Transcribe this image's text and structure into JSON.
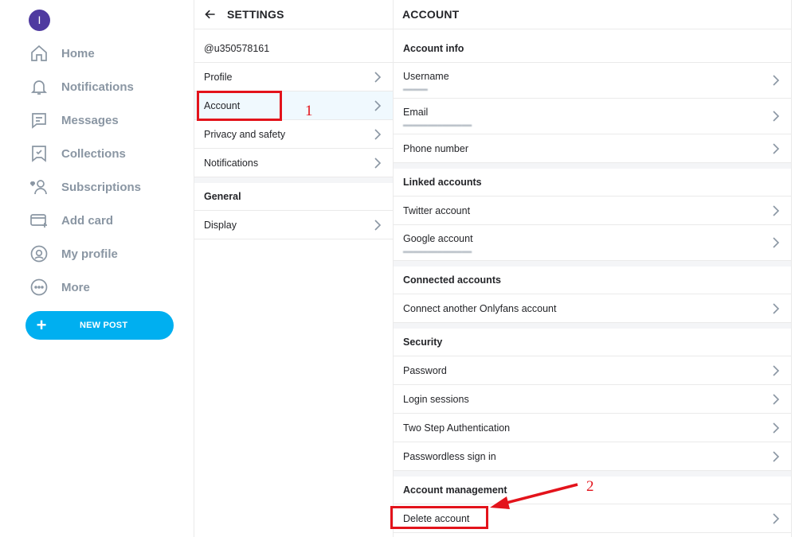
{
  "nav": {
    "avatar_initial": "I",
    "items": [
      {
        "label": "Home",
        "icon": "home-icon"
      },
      {
        "label": "Notifications",
        "icon": "bell-icon"
      },
      {
        "label": "Messages",
        "icon": "message-icon"
      },
      {
        "label": "Collections",
        "icon": "bookmark-icon"
      },
      {
        "label": "Subscriptions",
        "icon": "subscriptions-icon"
      },
      {
        "label": "Add card",
        "icon": "card-icon"
      },
      {
        "label": "My profile",
        "icon": "profile-icon"
      },
      {
        "label": "More",
        "icon": "more-icon"
      }
    ],
    "new_post_label": "NEW POST"
  },
  "settings": {
    "title": "SETTINGS",
    "username": "@u350578161",
    "items": [
      "Profile",
      "Account",
      "Privacy and safety",
      "Notifications"
    ],
    "active_item": "Account",
    "general_heading": "General",
    "general_items": [
      "Display"
    ]
  },
  "account": {
    "title": "ACCOUNT",
    "account_info": {
      "heading": "Account info",
      "username_label": "Username",
      "email_label": "Email",
      "phone_label": "Phone number"
    },
    "linked": {
      "heading": "Linked accounts",
      "twitter_label": "Twitter account",
      "google_label": "Google account"
    },
    "connected": {
      "heading": "Connected accounts",
      "connect_label": "Connect another Onlyfans account"
    },
    "security": {
      "heading": "Security",
      "items": [
        "Password",
        "Login sessions",
        "Two Step Authentication",
        "Passwordless sign in"
      ]
    },
    "management": {
      "heading": "Account management",
      "delete_label": "Delete account"
    }
  },
  "annotations": {
    "step1": "1",
    "step2": "2",
    "color": "#e3131b"
  },
  "colors": {
    "accent": "#00aff0",
    "nav_text": "#8a96a3",
    "avatar": "#4f3aa0"
  }
}
